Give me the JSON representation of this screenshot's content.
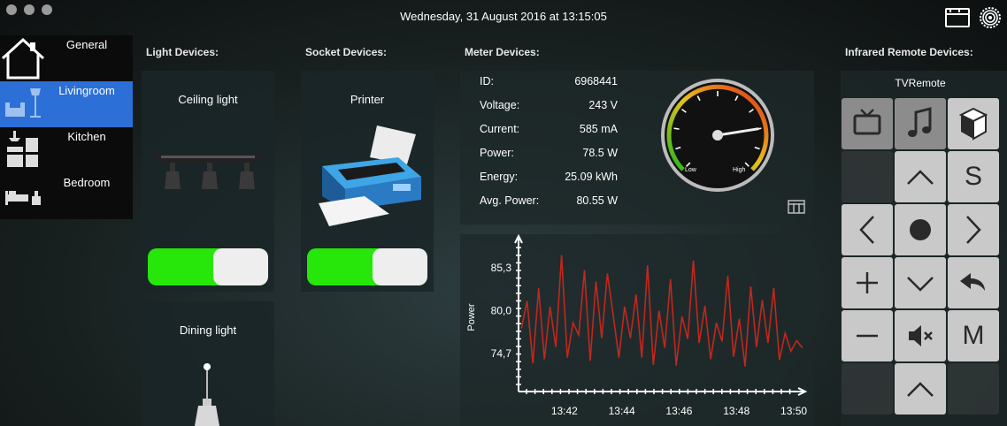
{
  "header": {
    "datetime": "Wednesday, 31 August 2016 at 13:15:05"
  },
  "sidebar": {
    "items": [
      {
        "label": "General",
        "icon": "home-icon",
        "active": false
      },
      {
        "label": "Livingroom",
        "icon": "livingroom-icon",
        "active": true
      },
      {
        "label": "Kitchen",
        "icon": "kitchen-icon",
        "active": false
      },
      {
        "label": "Bedroom",
        "icon": "bedroom-icon",
        "active": false
      }
    ]
  },
  "sections": {
    "light": "Light Devices:",
    "socket": "Socket Devices:",
    "meter": "Meter Devices:",
    "remote": "Infrared Remote Devices:"
  },
  "lights": [
    {
      "label": "Ceiling light",
      "on": true
    },
    {
      "label": "Dining light"
    }
  ],
  "sockets": [
    {
      "label": "Printer",
      "on": true
    }
  ],
  "meter": {
    "rows": [
      {
        "key": "ID:",
        "value": "6968441"
      },
      {
        "key": "Voltage:",
        "value": "243 V"
      },
      {
        "key": "Current:",
        "value": "585 mA"
      },
      {
        "key": "Power:",
        "value": "78.5 W"
      },
      {
        "key": "Energy:",
        "value": "25.09 kWh"
      },
      {
        "key": "Avg. Power:",
        "value": "80.55 W"
      }
    ],
    "gauge": {
      "low_label": "Low",
      "high_label": "High",
      "level": 0.8
    }
  },
  "chart_data": {
    "type": "line",
    "ylabel": "Power",
    "xlabel": "",
    "yticks": [
      "74,7",
      "80,0",
      "85,3"
    ],
    "ytick_values": [
      74.7,
      80.0,
      85.3
    ],
    "xticks": [
      "13:42",
      "13:44",
      "13:46",
      "13:48",
      "13:50"
    ],
    "xtick_values": [
      42,
      44,
      46,
      48,
      50
    ],
    "xlim": [
      40.4,
      50.4
    ],
    "ylim": [
      70.0,
      88.8
    ],
    "x": [
      40.5,
      40.7,
      40.9,
      41.1,
      41.3,
      41.5,
      41.7,
      41.9,
      42.1,
      42.3,
      42.5,
      42.7,
      42.9,
      43.1,
      43.3,
      43.5,
      43.7,
      43.9,
      44.1,
      44.3,
      44.5,
      44.7,
      44.9,
      45.1,
      45.3,
      45.5,
      45.7,
      45.9,
      46.1,
      46.3,
      46.5,
      46.7,
      46.9,
      47.1,
      47.3,
      47.5,
      47.7,
      47.9,
      48.1,
      48.3,
      48.5,
      48.7,
      48.9,
      49.1,
      49.3,
      49.5,
      49.7,
      49.9,
      50.1,
      50.3
    ],
    "values": [
      77.8,
      81.2,
      73.5,
      82.8,
      74.0,
      80.5,
      75.5,
      86.9,
      74.2,
      78.5,
      77.0,
      85.0,
      73.8,
      83.6,
      76.6,
      84.6,
      79.5,
      74.2,
      80.5,
      76.6,
      82.0,
      74.2,
      85.6,
      73.3,
      80.0,
      75.4,
      83.9,
      73.2,
      79.3,
      76.5,
      86.2,
      76.0,
      80.6,
      74.0,
      78.5,
      76.2,
      84.3,
      74.3,
      79.0,
      73.1,
      83.0,
      75.5,
      81.3,
      76.0,
      82.8,
      73.9,
      77.2,
      75.0,
      76.3,
      75.4
    ],
    "line_color": "#c0281e"
  },
  "remote": {
    "title": "TVRemote",
    "buttons": [
      {
        "icon": "tv-icon",
        "label": ""
      },
      {
        "icon": "music-icon",
        "label": ""
      },
      {
        "icon": "box-icon",
        "label": ""
      },
      {
        "icon": "up-icon",
        "label": ""
      },
      {
        "icon": "",
        "label": "S"
      },
      {
        "icon": "left-icon",
        "label": ""
      },
      {
        "icon": "ok-icon",
        "label": ""
      },
      {
        "icon": "right-icon",
        "label": ""
      },
      {
        "icon": "plus-icon",
        "label": ""
      },
      {
        "icon": "down-icon",
        "label": ""
      },
      {
        "icon": "back-icon",
        "label": ""
      },
      {
        "icon": "minus-icon",
        "label": ""
      },
      {
        "icon": "mute-icon",
        "label": ""
      },
      {
        "icon": "",
        "label": "M"
      },
      {
        "icon": "up-icon",
        "label": ""
      }
    ]
  },
  "colors": {
    "accent": "#2c6fd6",
    "toggle_on": "#26e60a",
    "chart_line": "#c0281e"
  }
}
